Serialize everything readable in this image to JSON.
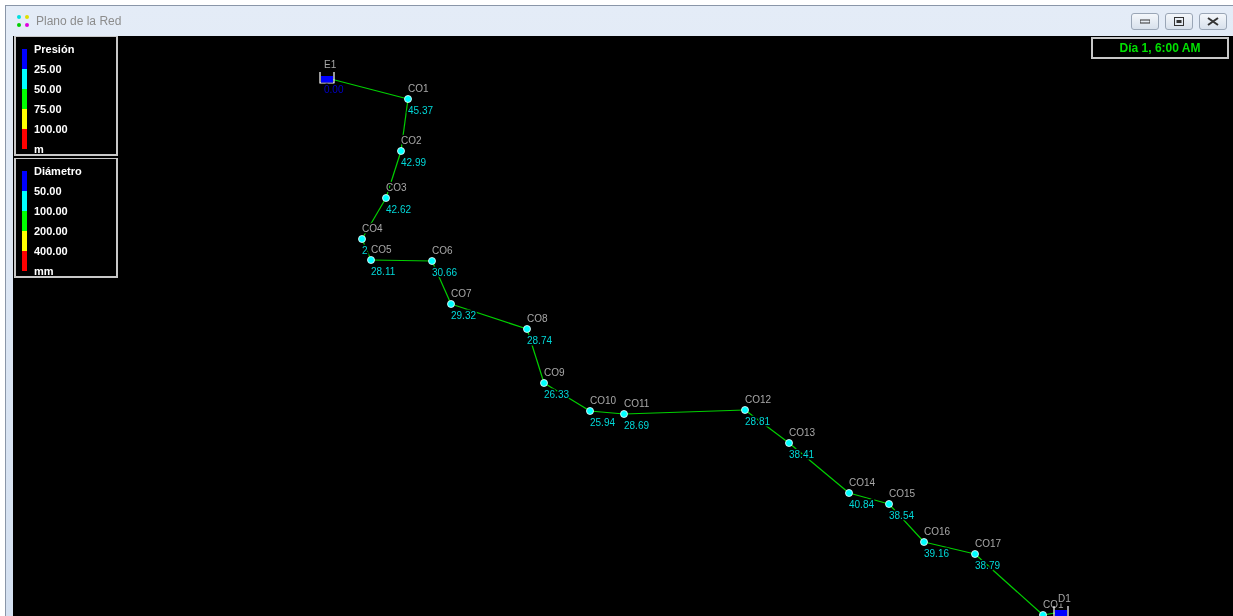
{
  "window": {
    "title": "Plano de la Red"
  },
  "legends": [
    {
      "title": "Presión",
      "unit": "m",
      "ticks": [
        "25.00",
        "50.00",
        "75.00",
        "100.00"
      ],
      "bands": [
        {
          "color": "#0000ff"
        },
        {
          "color": "#00ffff"
        },
        {
          "color": "#00ff00"
        },
        {
          "color": "#ffff00"
        },
        {
          "color": "#ff0000"
        }
      ]
    },
    {
      "title": "Diámetro",
      "unit": "mm",
      "ticks": [
        "50.00",
        "100.00",
        "200.00",
        "400.00"
      ],
      "bands": [
        {
          "color": "#0000ff"
        },
        {
          "color": "#00ffff"
        },
        {
          "color": "#00ff00"
        },
        {
          "color": "#ffff00"
        },
        {
          "color": "#ff0000"
        }
      ]
    }
  ],
  "time": "Día 1, 6:00 AM",
  "nodes": [
    {
      "kind": "tank",
      "label": "E1",
      "value": "0.00",
      "color": "#0000ff"
    },
    {
      "kind": "junction",
      "label": "CO1",
      "value": "45.37",
      "color": "#00ffff"
    },
    {
      "kind": "junction",
      "label": "CO2",
      "value": "42.99",
      "color": "#00ffff"
    },
    {
      "kind": "junction",
      "label": "CO3",
      "value": "42.62",
      "color": "#00ffff"
    },
    {
      "kind": "junction",
      "label": "CO4",
      "value": "2",
      "color": "#00ffff"
    },
    {
      "kind": "junction",
      "label": "CO5",
      "value": "28.11",
      "color": "#00ffff"
    },
    {
      "kind": "junction",
      "label": "CO6",
      "value": "30.66",
      "color": "#00ffff"
    },
    {
      "kind": "junction",
      "label": "CO7",
      "value": "29.32",
      "color": "#00ffff"
    },
    {
      "kind": "junction",
      "label": "CO8",
      "value": "28.74",
      "color": "#00ffff"
    },
    {
      "kind": "junction",
      "label": "CO9",
      "value": "26.33",
      "color": "#00ffff"
    },
    {
      "kind": "junction",
      "label": "CO10",
      "value": "25.94",
      "color": "#00ffff"
    },
    {
      "kind": "junction",
      "label": "CO11",
      "value": "28.69",
      "color": "#00ffff"
    },
    {
      "kind": "junction",
      "label": "CO12",
      "value": "28.81",
      "color": "#00ffff"
    },
    {
      "kind": "junction",
      "label": "CO13",
      "value": "38.41",
      "color": "#00ffff"
    },
    {
      "kind": "junction",
      "label": "CO14",
      "value": "40.84",
      "color": "#00ffff"
    },
    {
      "kind": "junction",
      "label": "CO15",
      "value": "38.54",
      "color": "#00ffff"
    },
    {
      "kind": "junction",
      "label": "CO16",
      "value": "39.16",
      "color": "#00ffff"
    },
    {
      "kind": "junction",
      "label": "CO17",
      "value": "38.79",
      "color": "#00ffff"
    },
    {
      "kind": "junction",
      "label": "CO1",
      "color": "#00ffff"
    },
    {
      "kind": "tank",
      "label": "D1",
      "color": "#0000ff"
    }
  ]
}
